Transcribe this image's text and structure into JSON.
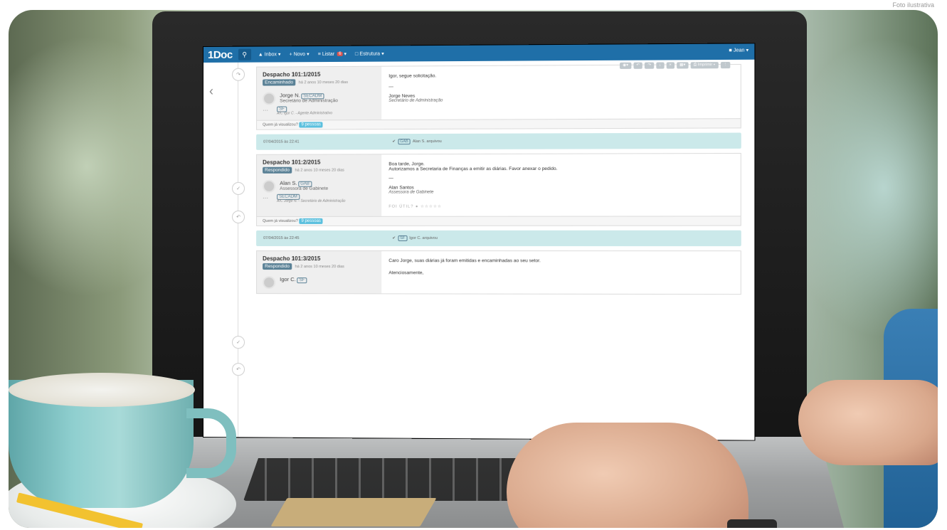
{
  "caption": "Foto ilustrativa",
  "navbar": {
    "brand": "1Doc",
    "items": [
      "Inbox",
      "Novo",
      "Listar",
      "Estrutura"
    ],
    "listar_badge": "6",
    "user": "Jean"
  },
  "toolbar": {
    "print_label": "Imprimir"
  },
  "entries": [
    {
      "title": "Despacho 101:1/2015",
      "status": "Encaminhado",
      "time_ago": "há 2 anos 10 meses 20 dias",
      "sender_name": "Jorge N.",
      "sender_tag": "SECADM",
      "sender_role": "Secretário de Administração",
      "dest_tag": "SF",
      "dest_ac": "A/C Igor C. - Agente Administrativo",
      "body": "Igor, segue solicitação.",
      "sig_name": "Jorge Neves",
      "sig_role": "Secretário de Administração",
      "viewed_label": "Quem já visualizou?",
      "viewed_count": "9 pessoas"
    },
    {
      "title": "Despacho 101:2/2015",
      "status": "Respondido",
      "time_ago": "há 2 anos 10 meses 20 dias",
      "sender_name": "Alan S.",
      "sender_tag": "GAB",
      "sender_role": "Assessora de Gabinete",
      "dest_tag": "SECADM",
      "dest_ac": "A/C Jorge N. - Secretário de Administração",
      "greeting": "Boa tarde, Jorge.",
      "body": "Autorizamos a Secretaria de Finanças a emitir as diárias. Favor anexar o pedido.",
      "sig_name": "Alan Santos",
      "sig_role": "Assessora de Gabinete",
      "rating_label": "FOI ÚTIL?",
      "viewed_label": "Quem já visualizou?",
      "viewed_count": "9 pessoas"
    },
    {
      "title": "Despacho 101:3/2015",
      "status": "Respondido",
      "time_ago": "há 2 anos 10 meses 20 dias",
      "sender_name": "Igor C.",
      "sender_tag": "SF",
      "body": "Caro Jorge, suas diárias já foram emitidas e encaminhadas ao seu setor.",
      "closing": "Atenciosamente,"
    }
  ],
  "events": [
    {
      "date": "07/04/2015 às 22:41",
      "tag": "GAB",
      "text": "Alan S. arquivou"
    },
    {
      "date": "07/04/2015 às 22:45",
      "tag": "SF",
      "text": "Igor C. arquivou"
    }
  ]
}
